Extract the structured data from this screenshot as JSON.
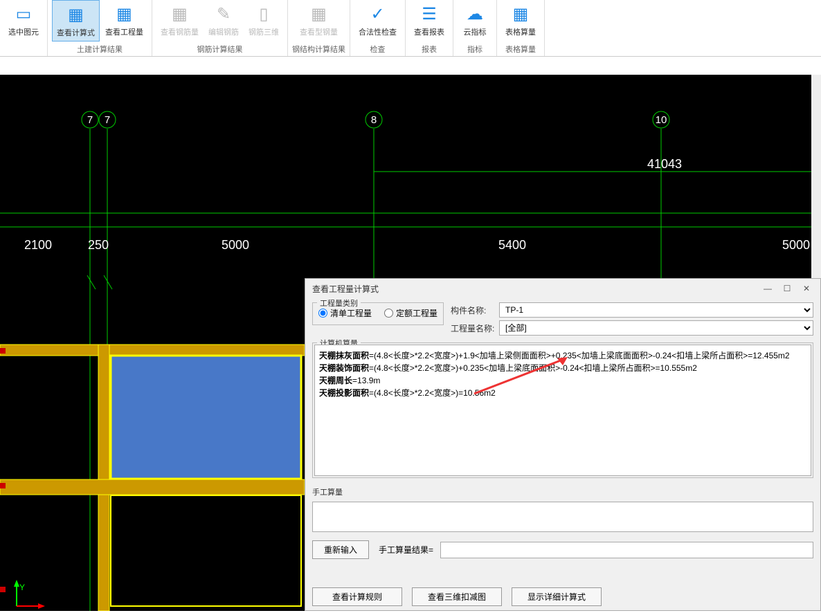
{
  "toolbar": {
    "groups": [
      {
        "label": "",
        "buttons": [
          {
            "label": "选中图元"
          }
        ]
      },
      {
        "label": "土建计算结果",
        "buttons": [
          {
            "label": "查看计算式"
          },
          {
            "label": "查看工程量"
          }
        ]
      },
      {
        "label": "钢筋计算结果",
        "buttons": [
          {
            "label": "查看钢筋量"
          },
          {
            "label": "编辑钢筋"
          },
          {
            "label": "钢筋三维"
          }
        ]
      },
      {
        "label": "钢结构计算结果",
        "buttons": [
          {
            "label": "查看型钢量"
          }
        ]
      },
      {
        "label": "检查",
        "buttons": [
          {
            "label": "合法性检查"
          }
        ]
      },
      {
        "label": "报表",
        "buttons": [
          {
            "label": "查看报表"
          }
        ]
      },
      {
        "label": "指标",
        "buttons": [
          {
            "label": "云指标"
          }
        ]
      },
      {
        "label": "表格算量",
        "buttons": [
          {
            "label": "表格算量"
          }
        ]
      }
    ]
  },
  "canvas": {
    "axis_labels": [
      "7",
      "7",
      "8",
      "10"
    ],
    "dim_value": "41043",
    "dims": [
      "2100",
      "250",
      "5000",
      "5400",
      "5000"
    ]
  },
  "dialog": {
    "title": "查看工程量计算式",
    "qty_category_legend": "工程量类别",
    "radio_list": "清单工程量",
    "radio_quota": "定额工程量",
    "label_component": "构件名称:",
    "value_component": "TP-1",
    "label_qty_name": "工程量名称:",
    "value_qty_name": "[全部]",
    "calc_legend": "计算机算量",
    "calc_lines": [
      {
        "b": "天棚抹灰面积",
        "rest": "=(4.8<长度>*2.2<宽度>)+1.9<加墙上梁侧面面积>+0.235<加墙上梁底面面积>-0.24<扣墙上梁所占面积>=12.455m2"
      },
      {
        "b": "天棚装饰面积",
        "rest": "=(4.8<长度>*2.2<宽度>)+0.235<加墙上梁底面面积>-0.24<扣墙上梁所占面积>=10.555m2"
      },
      {
        "b": "天棚周长",
        "rest": "=13.9m"
      },
      {
        "b": "天棚投影面积",
        "rest": "=(4.8<长度>*2.2<宽度>)=10.56m2"
      }
    ],
    "manual_legend": "手工算量",
    "btn_reinput": "重新输入",
    "manual_result_label": "手工算量结果=",
    "btn_rule": "查看计算规则",
    "btn_3d": "查看三维扣减图",
    "btn_detail": "显示详细计算式"
  }
}
